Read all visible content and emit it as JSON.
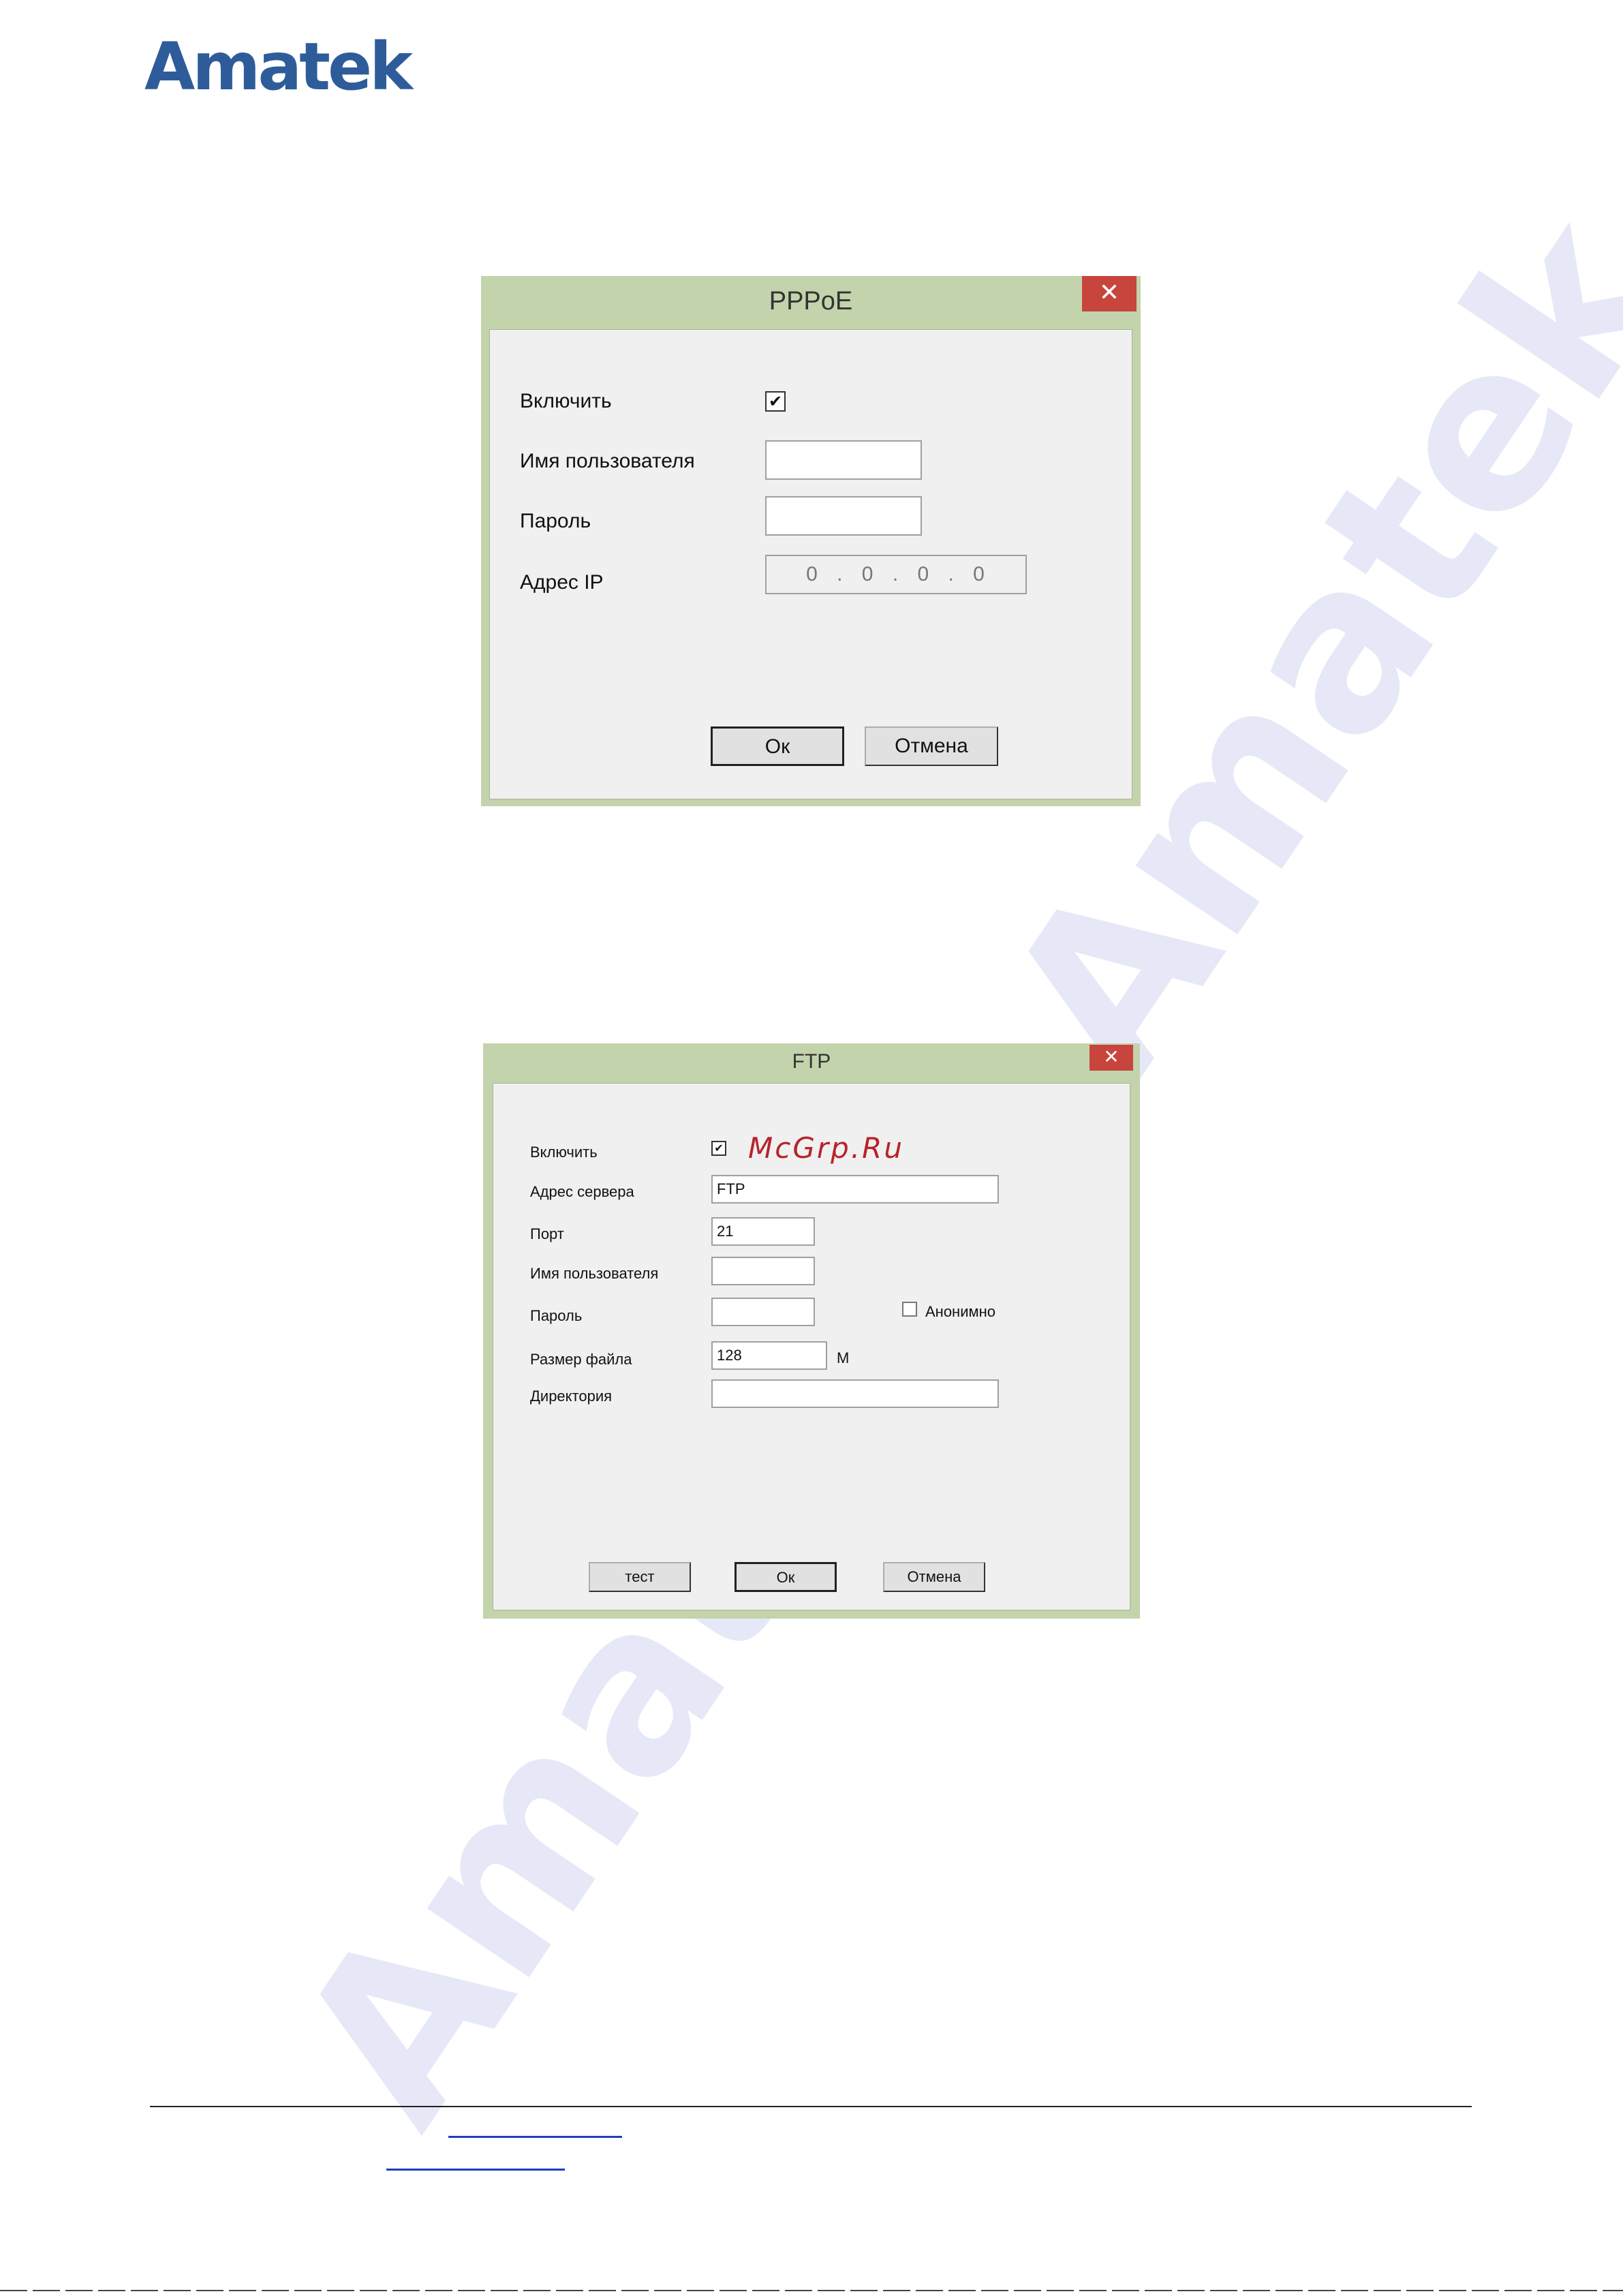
{
  "logo": "Amatek",
  "watermark": "Amatek",
  "pppoe": {
    "title": "PPPoE",
    "close": "✕",
    "enable_label": "Включить",
    "enable_checked": true,
    "username_label": "Имя пользователя",
    "username_value": "",
    "password_label": "Пароль",
    "password_value": "",
    "ip_label": "Адрес IP",
    "ip_value": "0 . 0 . 0 . 0",
    "ok": "Ок",
    "cancel": "Отмена"
  },
  "ftp": {
    "title": "FTP",
    "close": "✕",
    "enable_label": "Включить",
    "enable_checked": true,
    "server_label": "Адрес сервера",
    "server_value": "FTP",
    "port_label": "Порт",
    "port_value": "21",
    "username_label": "Имя пользователя",
    "username_value": "",
    "password_label": "Пароль",
    "password_value": "",
    "anonymous_label": "Анонимно",
    "anonymous_checked": false,
    "filesize_label": "Размер файла",
    "filesize_value": "128",
    "filesize_unit": "M",
    "directory_label": "Директория",
    "directory_value": "",
    "test": "тест",
    "ok": "Ок",
    "cancel": "Отмена"
  },
  "mcgrp": "McGrp.Ru"
}
